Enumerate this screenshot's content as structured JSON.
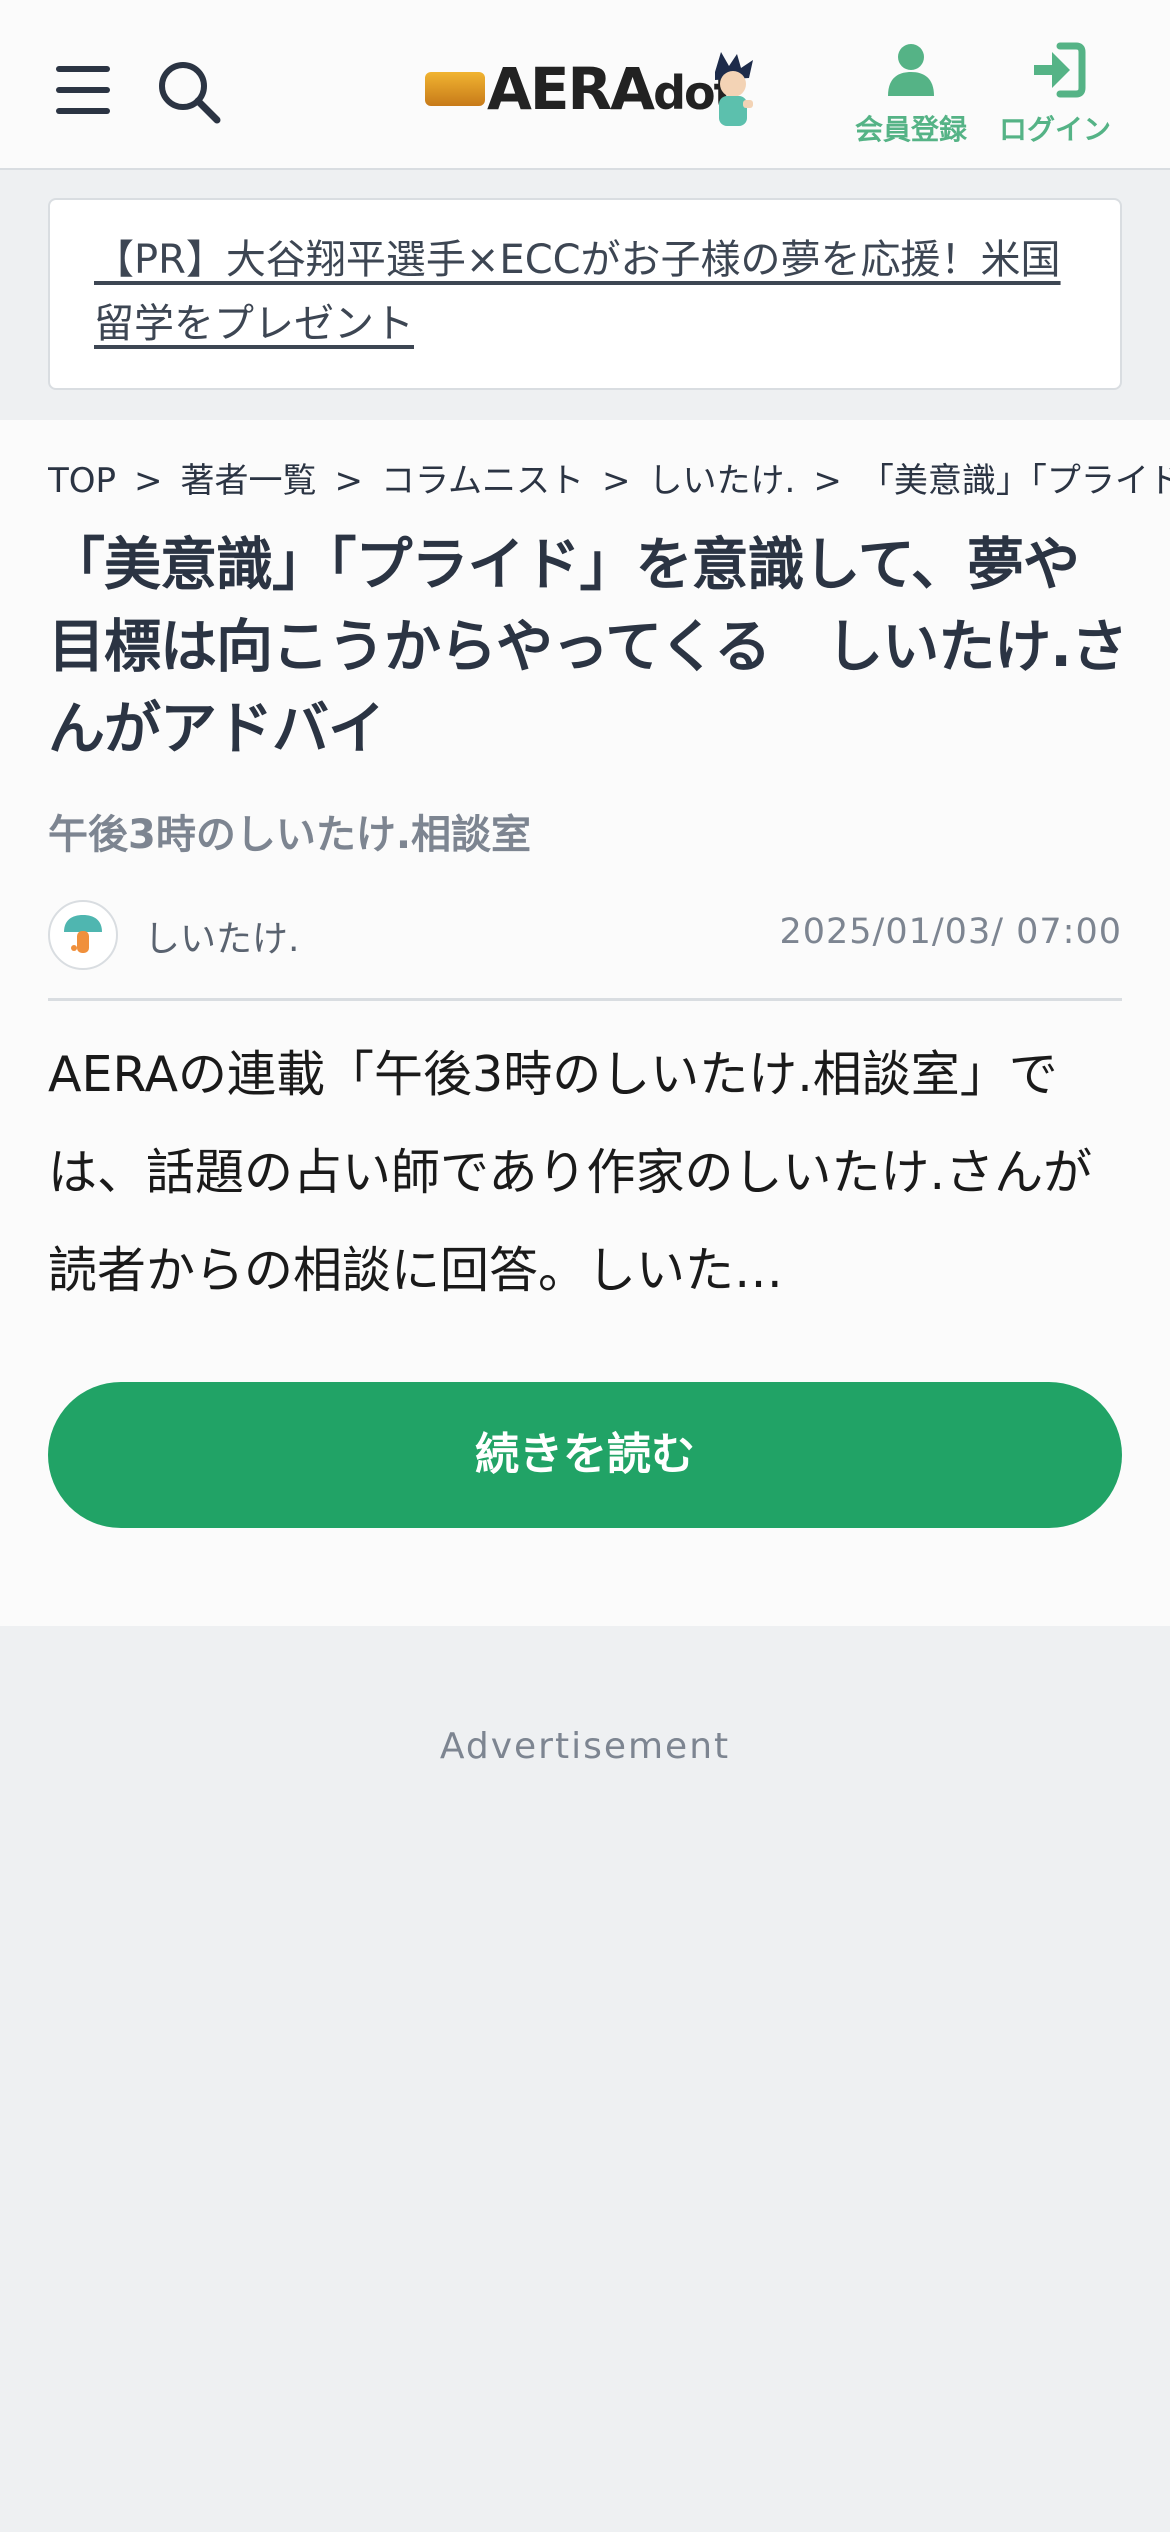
{
  "header": {
    "logo_text_main": "AERA",
    "logo_text_dot": "dot.",
    "register_label": "会員登録",
    "login_label": "ログイン"
  },
  "promo": {
    "text": "【PR】大谷翔平選手×ECCがお子様の夢を応援！米国留学をプレゼント"
  },
  "breadcrumb": {
    "items": [
      "TOP",
      "著者一覧",
      "コラムニスト",
      "しいたけ.",
      "「美意識」「プライド」を意識して、夢や目標は向こうからやってくる"
    ],
    "separator": ">"
  },
  "article": {
    "title": "「美意識」「プライド」を意識して、夢や目標は向こうからやってくる　しいたけ.さんがアドバイ",
    "series": "午後3時のしいたけ.相談室",
    "author": "しいたけ.",
    "date": "2025/01/03/ 07:00",
    "lead": "AERAの連載「午後3時のしいたけ.相談室」では、話題の占い師であり作家のしいたけ.さんが読者からの相談に回答。しいた…",
    "read_more_label": "続きを読む"
  },
  "ad": {
    "label": "Advertisement"
  },
  "colors": {
    "accent_green": "#21a366",
    "header_icon_green": "#55b386",
    "text_dark": "#2b3443",
    "text_muted": "#7d8591"
  },
  "icons": {
    "menu": "hamburger-menu-icon",
    "search": "search-icon",
    "register": "user-icon",
    "login": "sign-in-icon"
  }
}
